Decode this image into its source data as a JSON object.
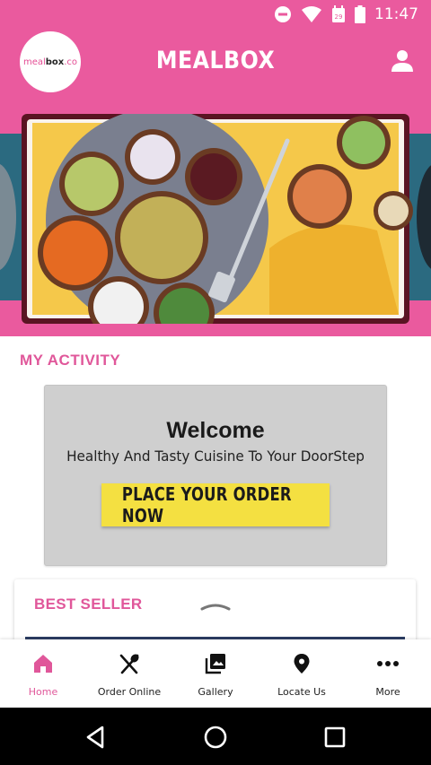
{
  "status_bar": {
    "time": "11:47",
    "calendar_day": "29",
    "icons": [
      "do-not-disturb-icon",
      "wifi-icon",
      "calendar-icon",
      "battery-icon"
    ]
  },
  "header": {
    "logo_text_prefix": "meal",
    "logo_text_bold": "box",
    "logo_text_suffix": ".co",
    "title": "MEALBOX",
    "profile_icon": "person-icon"
  },
  "activity": {
    "section_title": "MY ACTIVITY",
    "welcome_heading": "Welcome",
    "welcome_subtitle": "Healthy And Tasty Cuisine To Your DoorStep",
    "cta_label": "PLACE YOUR ORDER NOW"
  },
  "best_seller": {
    "title": "BEST SELLER"
  },
  "bottom_nav": {
    "items": [
      {
        "label": "Home",
        "icon": "home-icon",
        "active": true
      },
      {
        "label": "Order Online",
        "icon": "fork-spoon-icon",
        "active": false
      },
      {
        "label": "Gallery",
        "icon": "gallery-icon",
        "active": false
      },
      {
        "label": "Locate Us",
        "icon": "location-pin-icon",
        "active": false
      },
      {
        "label": "More",
        "icon": "more-dots-icon",
        "active": false
      }
    ]
  },
  "colors": {
    "brand_pink": "#ea5a9e",
    "accent_pink_text": "#e0579a",
    "cta_yellow": "#f4e041",
    "card_gray": "#cfcfcf"
  }
}
